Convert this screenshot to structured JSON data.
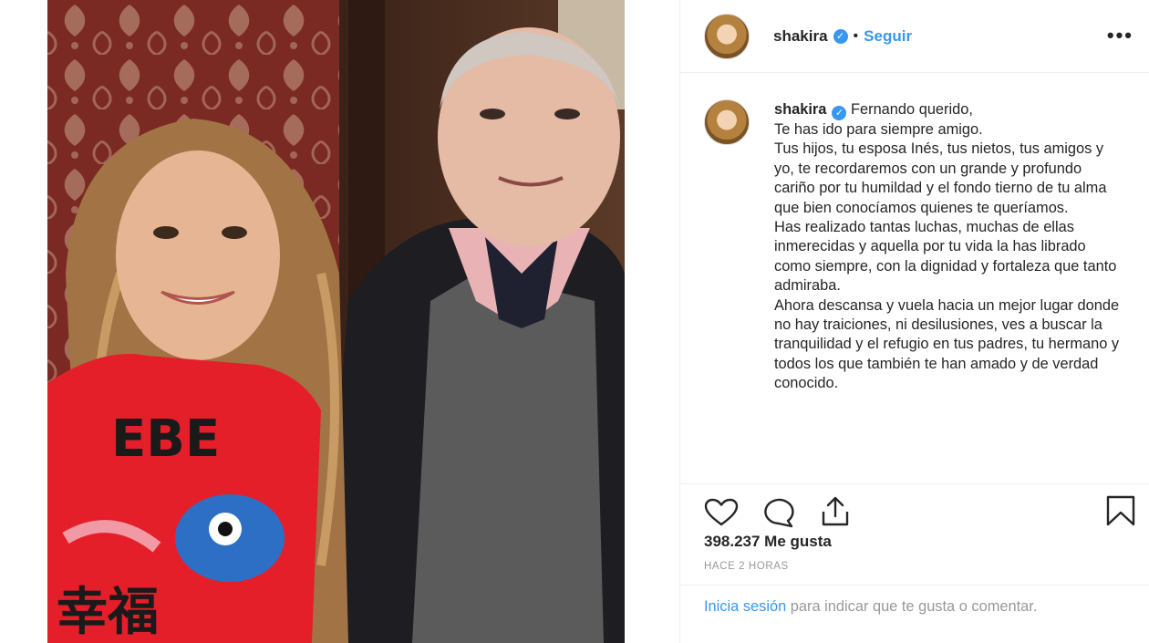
{
  "post": {
    "username": "shakira",
    "follow_label": "Seguir",
    "dot": "•",
    "more": "•••",
    "verified_glyph": "✓",
    "caption": "Fernando querido,\nTe has ido para siempre amigo.\nTus hijos, tu esposa Inés, tus nietos, tus amigos y yo, te recordaremos con un grande y profundo cariño por tu humildad y el fondo tierno de tu alma que bien conocíamos quienes te queríamos.\nHas realizado tantas luchas, muchas de ellas inmerecidas y aquella por tu vida la has librado como siempre, con la dignidad y fortaleza que tanto admiraba.\nAhora descansa y vuela hacia un mejor lugar donde no hay traiciones, ni desilusiones, ves a buscar la tranquilidad y el refugio en tus padres, tu hermano y todos los que también te han amado y de verdad conocido.",
    "likes": "398.237 Me gusta",
    "time": "HACE 2 HORAS"
  },
  "login": {
    "link": "Inicia sesión",
    "rest": " para indicar que te gusta o comentar."
  },
  "icons": {
    "like": "heart-icon",
    "comment": "comment-icon",
    "share": "share-icon",
    "save": "bookmark-icon"
  },
  "colors": {
    "accent": "#3897f0",
    "text": "#262626",
    "muted": "#999999",
    "border": "#efefef"
  }
}
